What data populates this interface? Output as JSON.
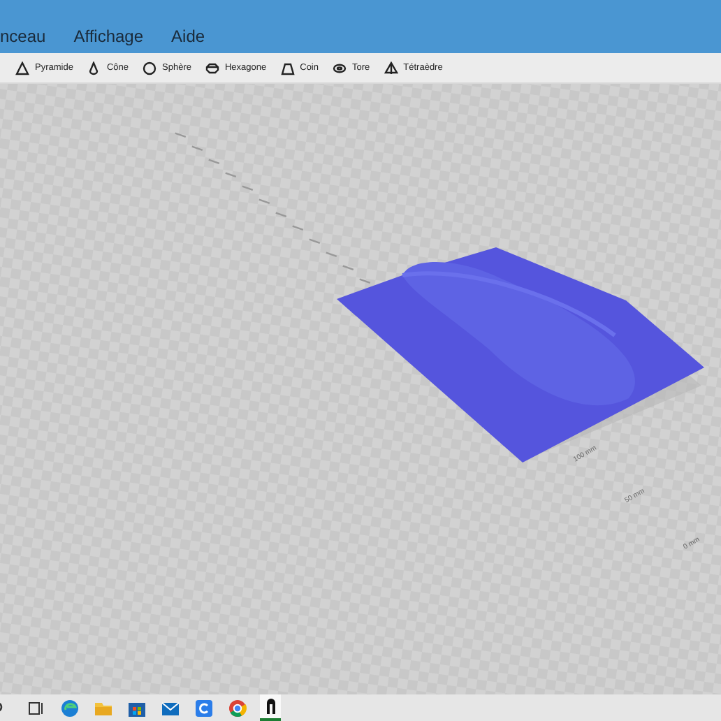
{
  "menu": [
    {
      "label": "nceau"
    },
    {
      "label": "Affichage"
    },
    {
      "label": "Aide"
    }
  ],
  "toolbar": [
    {
      "label": "Pyramide",
      "kind": "pyramid"
    },
    {
      "label": "Cône",
      "kind": "cone"
    },
    {
      "label": "Sphère",
      "kind": "sphere"
    },
    {
      "label": "Hexagone",
      "kind": "hexagon"
    },
    {
      "label": "Coin",
      "kind": "wedge"
    },
    {
      "label": "Tore",
      "kind": "torus"
    },
    {
      "label": "Tétraèdre",
      "kind": "tetra"
    }
  ],
  "viewport": {
    "scale_labels": [
      "100 mm",
      "50 mm",
      "0 mm"
    ]
  },
  "taskbar": [
    {
      "kind": "search",
      "selected": false
    },
    {
      "kind": "taskview",
      "selected": false
    },
    {
      "kind": "edge",
      "selected": false
    },
    {
      "kind": "files",
      "selected": false
    },
    {
      "kind": "store",
      "selected": false
    },
    {
      "kind": "mail",
      "selected": false
    },
    {
      "kind": "c",
      "selected": false
    },
    {
      "kind": "chrome",
      "selected": false
    },
    {
      "kind": "app",
      "selected": true
    }
  ]
}
